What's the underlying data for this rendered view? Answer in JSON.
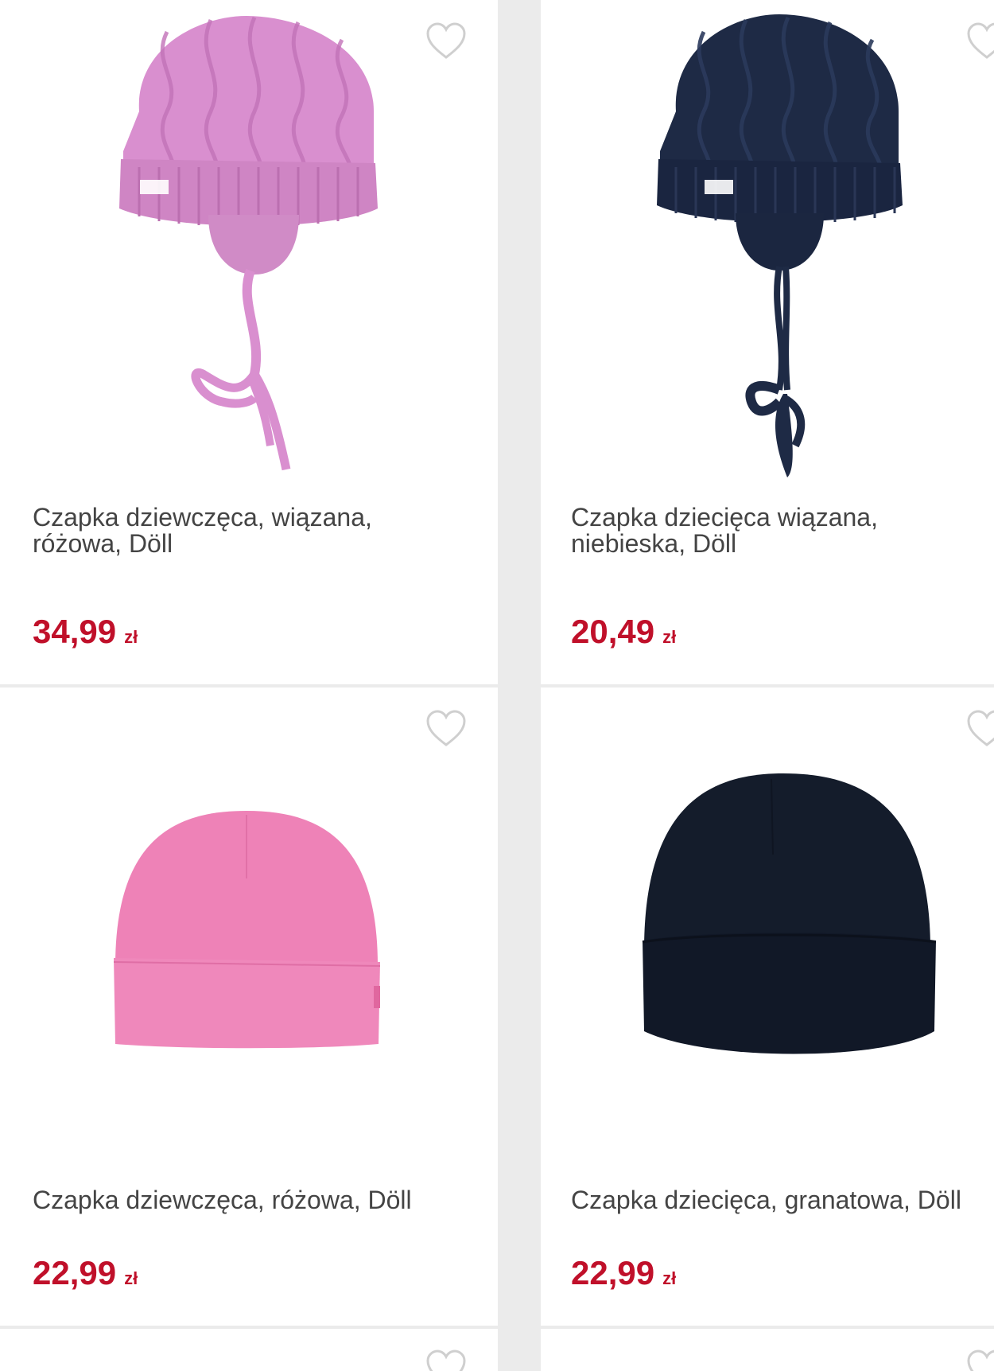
{
  "products": [
    {
      "title": "Czapka dziewczęca, wiązana, różowa, Döll",
      "price": "34,99",
      "currency": "zł",
      "image": "pink-knitted-tied-hat",
      "color": "#d98fcf"
    },
    {
      "title": "Czapka dziecięca wiązana, niebieska, Döll",
      "price": "20,49",
      "currency": "zł",
      "image": "navy-knitted-tied-hat",
      "color": "#1e2a45"
    },
    {
      "title": "Czapka dziewczęca, różowa, Döll",
      "price": "22,99",
      "currency": "zł",
      "image": "pink-beanie",
      "color": "#ee82b7"
    },
    {
      "title": "Czapka dziecięca, granatowa, Döll",
      "price": "22,99",
      "currency": "zł",
      "image": "navy-beanie",
      "color": "#141c2b"
    }
  ],
  "icons": {
    "favorite": "heart-outline-icon"
  },
  "colors": {
    "price": "#c0102a",
    "title": "#444444",
    "background": "#ebebeb",
    "card": "#ffffff"
  }
}
